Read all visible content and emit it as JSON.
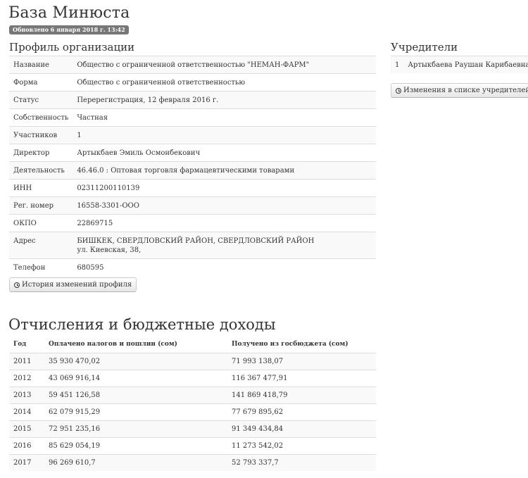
{
  "page": {
    "title": "База Минюста",
    "updated": "Обновлено 6 января 2018 г. 13:42"
  },
  "profile": {
    "title": "Профиль организации",
    "rows": [
      {
        "key": "Название",
        "value": "Общество с ограниченной ответственностью  \"НЕМАН-ФАРМ\""
      },
      {
        "key": "Форма",
        "value": "Общество с ограниченной ответственностью"
      },
      {
        "key": "Статус",
        "value": "Перерегистрация, 12 февраля 2016 г."
      },
      {
        "key": "Собственность",
        "value": "Частная"
      },
      {
        "key": "Участников",
        "value": "1"
      },
      {
        "key": "Директор",
        "value": "Артыкбаев Эмиль Осмонбекович"
      },
      {
        "key": "Деятельность",
        "value": "46.46.0 : Оптовая торговля фармацевтическими товарами"
      },
      {
        "key": "ИНН",
        "value": "02311200110139"
      },
      {
        "key": "Рег. номер",
        "value": "16558-3301-ООО"
      },
      {
        "key": "ОКПО",
        "value": "22869715"
      },
      {
        "key": "Адрес",
        "value": "БИШКЕК, СВЕРДЛОВСКИЙ РАЙОН, СВЕРДЛОВСКИЙ РАЙОН",
        "value2": "ул. Киевская, 38,"
      },
      {
        "key": "Телефон",
        "value": "680595"
      }
    ],
    "history_button": "История изменений профиля"
  },
  "founders": {
    "title": "Учредители",
    "items": [
      {
        "num": "1",
        "name": "Артыкбаева Раушан Карибаевна"
      }
    ],
    "history_button": "Изменения в списке учредителей"
  },
  "income": {
    "title": "Отчисления и бюджетные доходы",
    "headers": {
      "year": "Год",
      "paid": "Оплачено налогов и пошлин (сом)",
      "received": "Получено из госбюджета (сом)"
    },
    "rows": [
      {
        "year": "2011",
        "paid": "35 930 470,02",
        "received": "71 993 138,07"
      },
      {
        "year": "2012",
        "paid": "43 069 916,14",
        "received": "116 367 477,91"
      },
      {
        "year": "2013",
        "paid": "59 451 126,58",
        "received": "141 869 418,79"
      },
      {
        "year": "2014",
        "paid": "62 079 915,29",
        "received": "77 679 895,62"
      },
      {
        "year": "2015",
        "paid": "72 951 235,16",
        "received": "91 349 434,84"
      },
      {
        "year": "2016",
        "paid": "85 629 054,19",
        "received": "11 273 542,02"
      },
      {
        "year": "2017",
        "paid": "96 269 610,7",
        "received": "52 793 337,7"
      }
    ]
  }
}
